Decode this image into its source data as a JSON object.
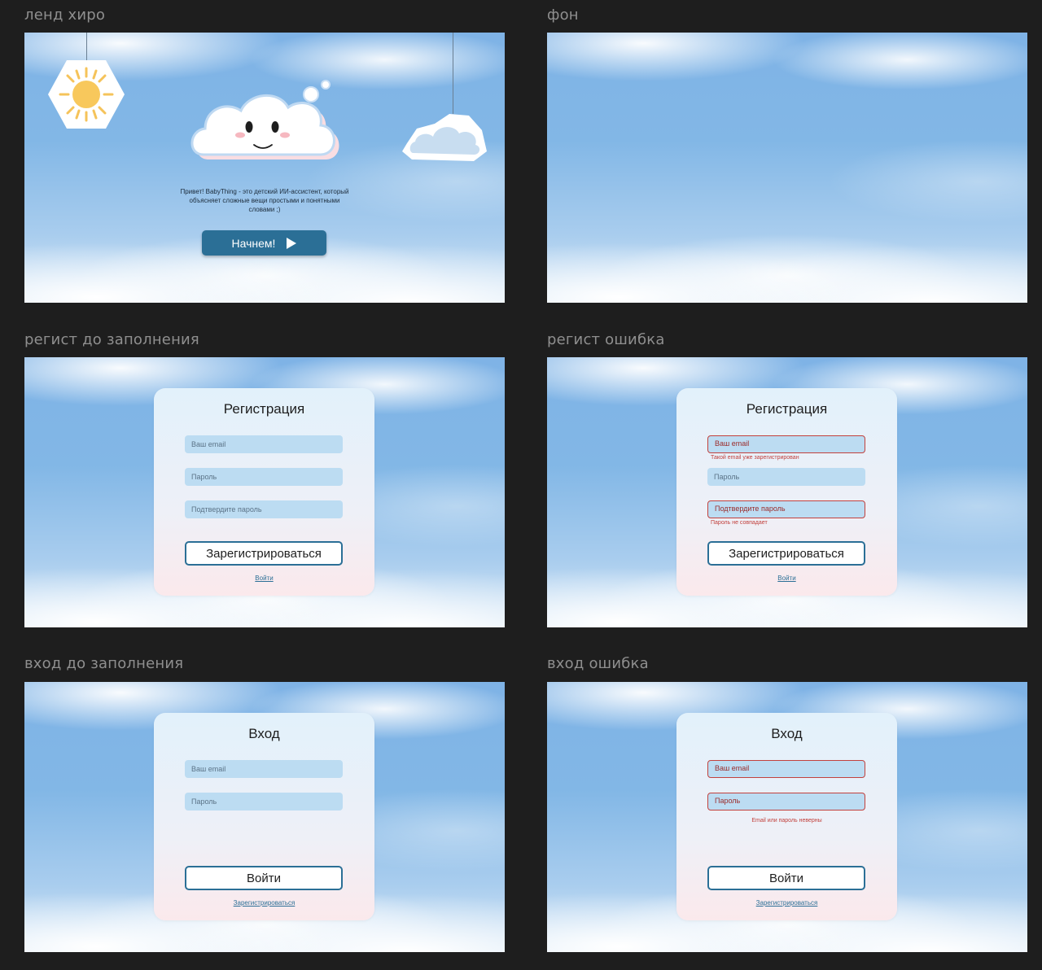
{
  "frames": {
    "hero": {
      "label": "ленд хиро",
      "text": "Привет! BabyThing - это детский ИИ-ассистент, который объясняет сложные вещи простыми и понятными словами ;)",
      "button": "Начнем!"
    },
    "background": {
      "label": "фон"
    },
    "register_empty": {
      "label": "регист до заполнения",
      "title": "Регистрация",
      "email_placeholder": "Ваш email",
      "password_placeholder": "Пароль",
      "confirm_placeholder": "Подтвердите пароль",
      "submit": "Зарегистрироваться",
      "link": "Войти"
    },
    "register_error": {
      "label": "регист ошибка",
      "title": "Регистрация",
      "email_placeholder": "Ваш email",
      "email_error": "Такой email уже зарегистрирован",
      "password_placeholder": "Пароль",
      "confirm_placeholder": "Подтвердите пароль",
      "confirm_error": "Пароль не совпадает",
      "submit": "Зарегистрироваться",
      "link": "Войти"
    },
    "login_empty": {
      "label": "вход до заполнения",
      "title": "Вход",
      "email_placeholder": "Ваш email",
      "password_placeholder": "Пароль",
      "submit": "Войти",
      "link": "Зарегистрироваться"
    },
    "login_error": {
      "label": "вход ошибка",
      "title": "Вход",
      "email_placeholder": "Ваш email",
      "password_placeholder": "Пароль",
      "error": "Email или пароль неверны",
      "submit": "Войти",
      "link": "Зарегистрироваться"
    }
  },
  "colors": {
    "canvas": "#1e1e1e",
    "accent": "#2b6f96",
    "error": "#c2413d",
    "field": "#bcdcf2"
  },
  "icons": [
    "sun-icon",
    "cloud-character",
    "paper-cloud-icon",
    "play-arrow-icon"
  ]
}
